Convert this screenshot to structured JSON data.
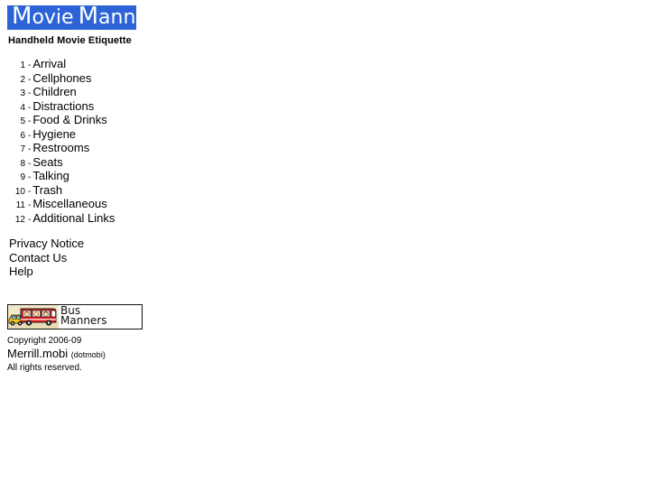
{
  "site": {
    "logo": {
      "word1_cap": "M",
      "word1_rest": "ovie",
      "word2_cap": "M",
      "word2_rest": "anners",
      "full_text": "Movie Manners",
      "background_color": "#2c63d6",
      "text_color": "#ffffff"
    },
    "tagline": "Handheld Movie Etiquette"
  },
  "nav": {
    "separator": "-",
    "items": [
      {
        "number": "1",
        "label": "Arrival"
      },
      {
        "number": "2",
        "label": "Cellphones"
      },
      {
        "number": "3",
        "label": "Children"
      },
      {
        "number": "4",
        "label": "Distractions"
      },
      {
        "number": "5",
        "label": "Food & Drinks"
      },
      {
        "number": "6",
        "label": "Hygiene"
      },
      {
        "number": "7",
        "label": "Restrooms"
      },
      {
        "number": "8",
        "label": "Seats"
      },
      {
        "number": "9",
        "label": "Talking"
      },
      {
        "number": "10",
        "label": "Trash"
      },
      {
        "number": "11",
        "label": "Miscellaneous"
      },
      {
        "number": "12",
        "label": "Additional Links"
      }
    ]
  },
  "footer_links": [
    {
      "label": "Privacy Notice"
    },
    {
      "label": "Contact Us"
    },
    {
      "label": "Help"
    }
  ],
  "bus_banner": {
    "line1": "Bus",
    "line2": "Manners",
    "alt": "Bus Manners",
    "art_name": "school-bus-with-children-illustration",
    "bus_color": "#e8221c",
    "art_background": "#f3e9c9"
  },
  "copyright": {
    "line1": "Copyright 2006-09",
    "line2_main": "Merrill.mobi",
    "line2_note": "(dotmobi)",
    "line3": "All rights reserved."
  }
}
